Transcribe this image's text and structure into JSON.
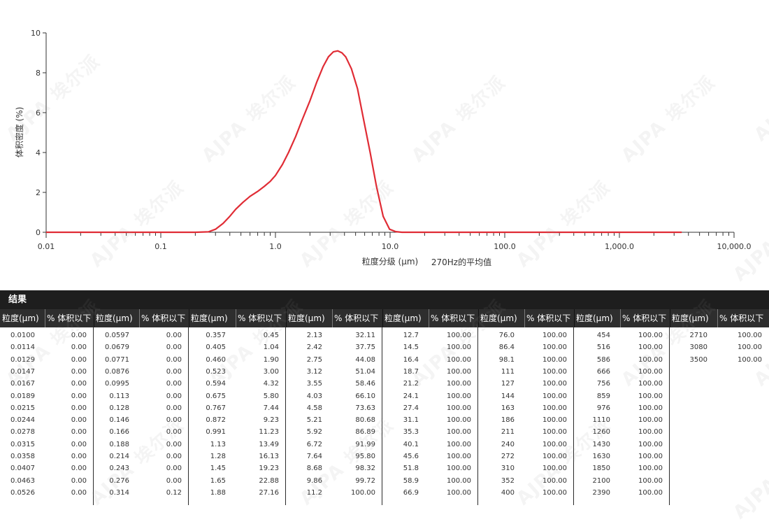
{
  "chart_data": {
    "type": "line",
    "x_scale": "log",
    "xlim": [
      0.01,
      10000
    ],
    "ylim": [
      0,
      10
    ],
    "x_ticks": [
      "0.01",
      "0.1",
      "1.0",
      "10.0",
      "100.0",
      "1,000.0",
      "10,000.0"
    ],
    "y_ticks": [
      "0",
      "2",
      "4",
      "6",
      "8",
      "10"
    ],
    "xlabel": "粒度分级 (μm)",
    "xlabel_note": "270Hz的平均值",
    "ylabel": "体积密度 (%)",
    "line_color": "#e02c35",
    "series": [
      {
        "x": [
          0.01,
          0.1,
          0.2,
          0.26,
          0.3,
          0.35,
          0.4,
          0.45,
          0.52,
          0.6,
          0.7,
          0.8,
          0.9,
          1.0,
          1.15,
          1.3,
          1.5,
          1.7,
          2.0,
          2.3,
          2.6,
          2.9,
          3.2,
          3.5,
          3.8,
          4.1,
          4.6,
          5.2,
          5.9,
          6.7,
          7.6,
          8.7,
          9.9,
          11.2,
          12.7,
          20,
          100,
          1000,
          3500
        ],
        "y": [
          0,
          0,
          0,
          0.02,
          0.15,
          0.45,
          0.8,
          1.15,
          1.5,
          1.8,
          2.05,
          2.3,
          2.55,
          2.85,
          3.4,
          4.0,
          4.8,
          5.6,
          6.6,
          7.55,
          8.3,
          8.8,
          9.05,
          9.1,
          9.0,
          8.8,
          8.2,
          7.2,
          5.6,
          4.0,
          2.3,
          0.8,
          0.15,
          0.03,
          0,
          0,
          0,
          0,
          0
        ]
      }
    ]
  },
  "results": {
    "title": "结果",
    "col_size_header": "粒度(μm)",
    "col_vol_header": "% 体积以下",
    "columns": [
      {
        "sizes": [
          "0.0100",
          "0.0114",
          "0.0129",
          "0.0147",
          "0.0167",
          "0.0189",
          "0.0215",
          "0.0244",
          "0.0278",
          "0.0315",
          "0.0358",
          "0.0407",
          "0.0463",
          "0.0526"
        ],
        "vols": [
          "0.00",
          "0.00",
          "0.00",
          "0.00",
          "0.00",
          "0.00",
          "0.00",
          "0.00",
          "0.00",
          "0.00",
          "0.00",
          "0.00",
          "0.00",
          "0.00"
        ]
      },
      {
        "sizes": [
          "0.0597",
          "0.0679",
          "0.0771",
          "0.0876",
          "0.0995",
          "0.113",
          "0.128",
          "0.146",
          "0.166",
          "0.188",
          "0.214",
          "0.243",
          "0.276",
          "0.314"
        ],
        "vols": [
          "0.00",
          "0.00",
          "0.00",
          "0.00",
          "0.00",
          "0.00",
          "0.00",
          "0.00",
          "0.00",
          "0.00",
          "0.00",
          "0.00",
          "0.00",
          "0.12"
        ]
      },
      {
        "sizes": [
          "0.357",
          "0.405",
          "0.460",
          "0.523",
          "0.594",
          "0.675",
          "0.767",
          "0.872",
          "0.991",
          "1.13",
          "1.28",
          "1.45",
          "1.65",
          "1.88"
        ],
        "vols": [
          "0.45",
          "1.04",
          "1.90",
          "3.00",
          "4.32",
          "5.80",
          "7.44",
          "9.23",
          "11.23",
          "13.49",
          "16.13",
          "19.23",
          "22.88",
          "27.16"
        ]
      },
      {
        "sizes": [
          "2.13",
          "2.42",
          "2.75",
          "3.12",
          "3.55",
          "4.03",
          "4.58",
          "5.21",
          "5.92",
          "6.72",
          "7.64",
          "8.68",
          "9.86",
          "11.2"
        ],
        "vols": [
          "32.11",
          "37.75",
          "44.08",
          "51.04",
          "58.46",
          "66.10",
          "73.63",
          "80.68",
          "86.89",
          "91.99",
          "95.80",
          "98.32",
          "99.72",
          "100.00"
        ]
      },
      {
        "sizes": [
          "12.7",
          "14.5",
          "16.4",
          "18.7",
          "21.2",
          "24.1",
          "27.4",
          "31.1",
          "35.3",
          "40.1",
          "45.6",
          "51.8",
          "58.9",
          "66.9"
        ],
        "vols": [
          "100.00",
          "100.00",
          "100.00",
          "100.00",
          "100.00",
          "100.00",
          "100.00",
          "100.00",
          "100.00",
          "100.00",
          "100.00",
          "100.00",
          "100.00",
          "100.00"
        ]
      },
      {
        "sizes": [
          "76.0",
          "86.4",
          "98.1",
          "111",
          "127",
          "144",
          "163",
          "186",
          "211",
          "240",
          "272",
          "310",
          "352",
          "400"
        ],
        "vols": [
          "100.00",
          "100.00",
          "100.00",
          "100.00",
          "100.00",
          "100.00",
          "100.00",
          "100.00",
          "100.00",
          "100.00",
          "100.00",
          "100.00",
          "100.00",
          "100.00"
        ]
      },
      {
        "sizes": [
          "454",
          "516",
          "586",
          "666",
          "756",
          "859",
          "976",
          "1110",
          "1260",
          "1430",
          "1630",
          "1850",
          "2100",
          "2390"
        ],
        "vols": [
          "100.00",
          "100.00",
          "100.00",
          "100.00",
          "100.00",
          "100.00",
          "100.00",
          "100.00",
          "100.00",
          "100.00",
          "100.00",
          "100.00",
          "100.00",
          "100.00"
        ]
      },
      {
        "sizes": [
          "2710",
          "3080",
          "3500"
        ],
        "vols": [
          "100.00",
          "100.00",
          "100.00"
        ]
      }
    ]
  },
  "watermark": {
    "text": "AJPA 埃尔派"
  }
}
